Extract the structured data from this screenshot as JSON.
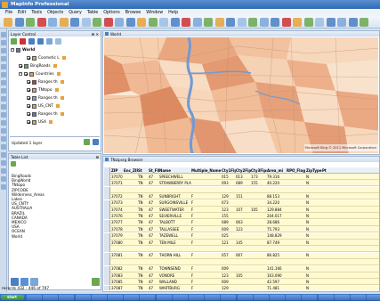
{
  "app": {
    "title": "MapInfo Professional"
  },
  "menu": [
    "File",
    "Edit",
    "Tools",
    "Objects",
    "Query",
    "Table",
    "Options",
    "Browse",
    "Window",
    "Help"
  ],
  "layer_control": {
    "title": "Layer Control",
    "close": "✕",
    "pin": "⊞",
    "tree": [
      {
        "label": "World",
        "level": 0,
        "kind": "map",
        "expander": "−"
      },
      {
        "label": "Cosmetic L",
        "level": 2,
        "kind": "layer"
      },
      {
        "label": "BingRoads",
        "level": 1,
        "kind": "layer"
      },
      {
        "label": "Countries",
        "level": 1,
        "kind": "group",
        "expander": "−"
      },
      {
        "label": "Ranges th",
        "level": 2,
        "kind": "layer"
      },
      {
        "label": "TNtopo",
        "level": 2,
        "kind": "layer"
      },
      {
        "label": "Ranges th",
        "level": 2,
        "kind": "layer"
      },
      {
        "label": "US_CNT",
        "level": 2,
        "kind": "layer"
      },
      {
        "label": "Ranges th",
        "level": 2,
        "kind": "layer"
      },
      {
        "label": "USA",
        "level": 2,
        "kind": "layer"
      }
    ],
    "footer": "Updated 1 layer"
  },
  "table_list": {
    "title": "Table List",
    "pin": "⊞",
    "items": [
      "BingRoads",
      "BingWorld",
      "TNtopo",
      "ZIPCODE",
      "Wilderness_Areas",
      "Lakes",
      "US_CNTY",
      "AUSTRALIA",
      "BRAZIL",
      "CANADA",
      "MEXICO",
      "USA",
      "OCEAN",
      "World"
    ]
  },
  "map_window": {
    "title": "World",
    "copyright": "Microsoft Bing © 2011 Microsoft Corporation"
  },
  "browser": {
    "title": "TNzipsrg Browser",
    "columns": [
      "ZIP",
      "Enc_ZIP",
      "St",
      "St_FIPS",
      "Name",
      "Multiple_Name",
      "Cty1Fips",
      "Cty2Fips",
      "Cty3Fips",
      "Area_mi",
      "RPO_Flag",
      "ZipType",
      "Pt"
    ],
    "rows": [
      [
        "37070",
        "",
        "TN",
        "47",
        "SPEECHWELL",
        "",
        "015",
        "013",
        "173",
        "79.316",
        "",
        "N",
        ""
      ],
      [
        "37071",
        "",
        "TN",
        "47",
        "STRAWBERRY PLAINS",
        "",
        "093",
        "089",
        "155",
        "40.220",
        "",
        "N",
        ""
      ],
      [
        "",
        "",
        "",
        "",
        "",
        "",
        "",
        "",
        "",
        "",
        "",
        "",
        ""
      ],
      [
        "37072",
        "",
        "TN",
        "47",
        "SUNBRIGHT",
        "F",
        "129",
        "151",
        "",
        "88.153",
        "",
        "N",
        ""
      ],
      [
        "37073",
        "",
        "TN",
        "47",
        "SURGOINSVILLE",
        "F",
        "073",
        "",
        "",
        "34.220",
        "",
        "N",
        ""
      ],
      [
        "37074",
        "",
        "TN",
        "47",
        "SWEETWATER",
        "F",
        "123",
        "107",
        "105",
        "129.884",
        "",
        "N",
        ""
      ],
      [
        "37076",
        "",
        "TN",
        "47",
        "SEVIERVILLE",
        "F",
        "155",
        "",
        "",
        "204.017",
        "",
        "N",
        ""
      ],
      [
        "37077",
        "",
        "TN",
        "47",
        "TALBOTT",
        "F",
        "089",
        "063",
        "",
        "28.686",
        "",
        "N",
        ""
      ],
      [
        "37078",
        "",
        "TN",
        "47",
        "TALLASSEE",
        "F",
        "009",
        "123",
        "",
        "75.793",
        "",
        "N",
        ""
      ],
      [
        "37079",
        "",
        "TN",
        "47",
        "TAZEWELL",
        "F",
        "025",
        "",
        "",
        "148.829",
        "",
        "N",
        ""
      ],
      [
        "37080",
        "",
        "TN",
        "47",
        "TEN MILE",
        "F",
        "121",
        "145",
        "",
        "87.749",
        "",
        "N",
        ""
      ],
      [
        "",
        "",
        "",
        "",
        "",
        "",
        "",
        "",
        "",
        "",
        "",
        "",
        ""
      ],
      [
        "37081",
        "",
        "TN",
        "47",
        "THORN HILL",
        "F",
        "057",
        "067",
        "",
        "86.825",
        "",
        "N",
        ""
      ],
      [
        "",
        "",
        "",
        "",
        "",
        "",
        "",
        "",
        "",
        "",
        "",
        "",
        ""
      ],
      [
        "37082",
        "",
        "TN",
        "47",
        "TOWNSEND",
        "F",
        "009",
        "",
        "",
        "141.166",
        "",
        "N",
        ""
      ],
      [
        "37083",
        "",
        "TN",
        "47",
        "VONORE",
        "F",
        "123",
        "105",
        "",
        "163.090",
        "",
        "N",
        ""
      ],
      [
        "37085",
        "",
        "TN",
        "47",
        "WALLAND",
        "F",
        "009",
        "",
        "",
        "42.597",
        "",
        "N",
        ""
      ],
      [
        "37087",
        "",
        "TN",
        "47",
        "WARTBURG",
        "F",
        "129",
        "",
        "",
        "71.481",
        "",
        "N",
        ""
      ]
    ]
  },
  "status": {
    "text": "records 432 - 446 of 797"
  },
  "taskbar": {
    "start": "start"
  }
}
